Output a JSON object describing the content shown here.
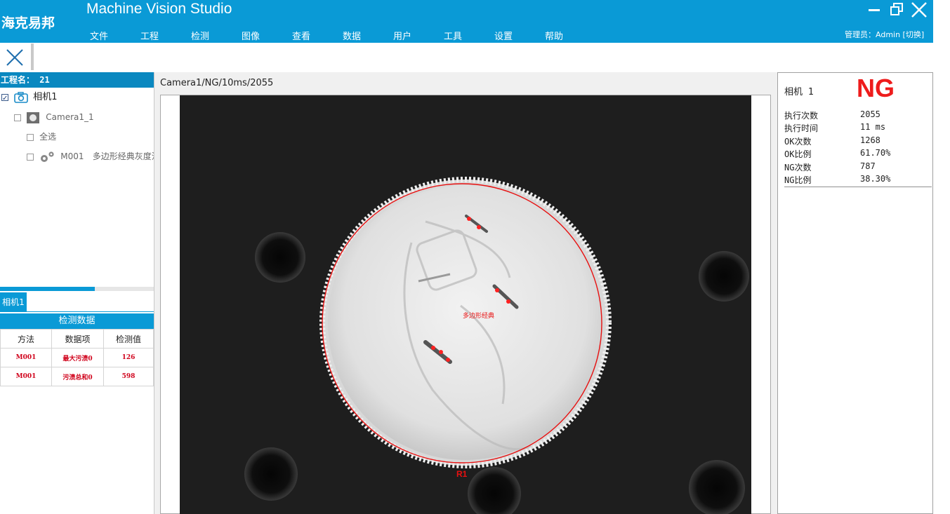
{
  "app": {
    "logo_text": "海克易邦",
    "title": "Machine Vision Studio",
    "user_info": "管理员：Admin  [切换]"
  },
  "menu": [
    "文件",
    "工程",
    "检测",
    "图像",
    "查看",
    "数据",
    "用户",
    "工具",
    "设置",
    "帮助"
  ],
  "project": {
    "header": "工程名： 21",
    "tree": {
      "camera": "相机1",
      "camera_sub": "Camera1_1",
      "select_all": "全选",
      "module_id": "M001",
      "module_name": "多边形经典灰度污"
    }
  },
  "camera_tab": "相机1",
  "detection": {
    "title": "检测数据",
    "headers": [
      "方法",
      "数据项",
      "检测值"
    ],
    "rows": [
      [
        "M001",
        "最大污渍0",
        "126"
      ],
      [
        "M001",
        "污渍总和0",
        "598"
      ]
    ]
  },
  "image_view": {
    "caption": "Camera1/NG/10ms/2055",
    "region_label": "R1",
    "tool_label": "多边形经典"
  },
  "stats": {
    "camera": "相机 1",
    "result": "NG",
    "result_color": "#ee1c1c",
    "items": [
      {
        "label": "执行次数",
        "value": "2055"
      },
      {
        "label": "执行时间",
        "value": "11 ms"
      },
      {
        "label": "OK次数",
        "value": "1268"
      },
      {
        "label": "OK比例",
        "value": "61.70%"
      },
      {
        "label": "NG次数",
        "value": "787"
      },
      {
        "label": "NG比例",
        "value": "38.30%"
      }
    ]
  },
  "colors": {
    "accent": "#0a9ad6",
    "defect": "#ff2020"
  }
}
